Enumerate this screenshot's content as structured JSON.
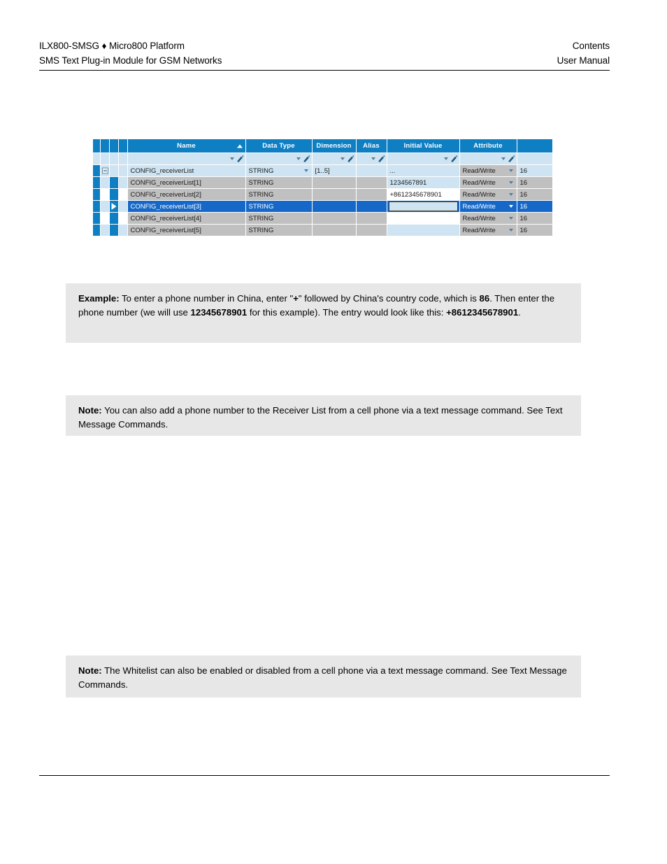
{
  "page": {
    "header": {
      "left_line_1": "ILX800-SMSG ♦ Micro800 Platform",
      "left_line_2": "SMS Text Plug-in Module for GSM Networks",
      "right_line_1": "Contents",
      "right_line_2": "User Manual"
    }
  },
  "grid": {
    "columns": [
      {
        "key": "name",
        "label": "Name",
        "sort": "ascending",
        "sort_icon": "sort-ascending-icon"
      },
      {
        "key": "data_type",
        "label": "Data Type"
      },
      {
        "key": "dimension",
        "label": "Dimension"
      },
      {
        "key": "alias",
        "label": "Alias"
      },
      {
        "key": "initial_value",
        "label": "Initial Value"
      },
      {
        "key": "attribute",
        "label": "Attribute"
      },
      {
        "key": "extra",
        "label": ""
      }
    ],
    "filter_row": {
      "dropdown_icon": "chevron-down-icon",
      "filter_icon": "filter-edit-icon",
      "name": "",
      "data_type": "",
      "dimension": "",
      "alias": "",
      "initial_value": "",
      "attribute": ""
    },
    "rows": [
      {
        "kind": "parent",
        "expander": "collapse-icon",
        "name": "CONFIG_receiverList",
        "data_type": "STRING",
        "data_type_caret": true,
        "dimension": "[1..5]",
        "alias": "",
        "initial_value": "...",
        "attribute": "Read/Write",
        "attribute_caret": true,
        "extra": "16",
        "selected": false
      },
      {
        "kind": "child",
        "name": "CONFIG_receiverList[1]",
        "data_type": "STRING",
        "data_type_caret": false,
        "dimension": "",
        "alias": "",
        "initial_value": "1234567891",
        "attribute": "Read/Write",
        "attribute_caret": true,
        "extra": "16",
        "selected": false
      },
      {
        "kind": "child",
        "name": "CONFIG_receiverList[2]",
        "data_type": "STRING",
        "data_type_caret": false,
        "dimension": "",
        "alias": "",
        "initial_value": "+8612345678901",
        "attribute": "Read/Write",
        "attribute_caret": true,
        "extra": "16",
        "selected": false
      },
      {
        "kind": "child",
        "name": "CONFIG_receiverList[3]",
        "data_type": "STRING",
        "data_type_caret": false,
        "dimension": "",
        "alias": "",
        "initial_value": "",
        "attribute": "Read/Write",
        "attribute_caret": true,
        "extra": "16",
        "selected": true,
        "row_pointer": "row-pointer-icon",
        "editing": true
      },
      {
        "kind": "child",
        "name": "CONFIG_receiverList[4]",
        "data_type": "STRING",
        "data_type_caret": false,
        "dimension": "",
        "alias": "",
        "initial_value": "",
        "attribute": "Read/Write",
        "attribute_caret": true,
        "extra": "16",
        "selected": false
      },
      {
        "kind": "child",
        "name": "CONFIG_receiverList[5]",
        "data_type": "STRING",
        "data_type_caret": false,
        "dimension": "",
        "alias": "",
        "initial_value": "",
        "attribute": "Read/Write",
        "attribute_caret": true,
        "extra": "16",
        "selected": false
      }
    ],
    "colors": {
      "header_blue": "#0f7fc4",
      "filter_blue": "#cfe4f2",
      "selection_blue": "#1668c8",
      "cell_gray": "#c0c0c0",
      "row_lightblue": "#cfe4f2"
    }
  },
  "callouts": {
    "example": {
      "label": "Example:",
      "text_1": " To enter a phone number in China, enter \"",
      "bold_plus": "+",
      "text_2": "\" followed by China's country code, which is ",
      "bold_86": "86",
      "text_3": ". Then enter the phone number (we will use ",
      "bold_number": "12345678901",
      "text_4": " for this example). The entry would look like this: ",
      "bold_full_number": "+8612345678901",
      "text_5": "."
    },
    "note_1": {
      "label": "Note:",
      "text": " You can also add a phone number to the Receiver List from a cell phone via a text message command. See Text Message Commands."
    },
    "note_2": {
      "label": "Note:",
      "text": " The Whitelist can also be enabled or disabled from a cell phone via a text message command. See Text Message Commands."
    }
  }
}
